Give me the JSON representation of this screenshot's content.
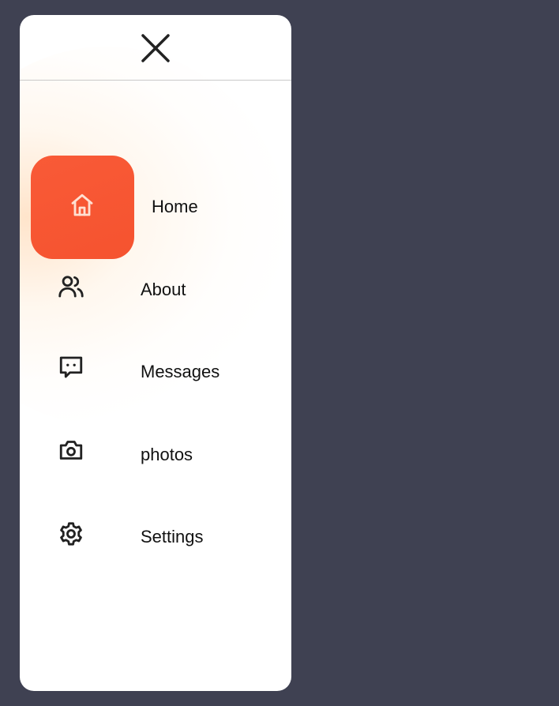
{
  "nav": {
    "items": [
      {
        "label": "Home",
        "icon": "home-icon",
        "active": true
      },
      {
        "label": "About",
        "icon": "users-icon",
        "active": false
      },
      {
        "label": "Messages",
        "icon": "message-icon",
        "active": false
      },
      {
        "label": "photos",
        "icon": "camera-icon",
        "active": false
      },
      {
        "label": "Settings",
        "icon": "gear-icon",
        "active": false
      }
    ]
  },
  "header": {
    "close_icon": "close-icon"
  },
  "colors": {
    "background": "#3f4152",
    "drawer": "#ffffff",
    "accent": "#f95a37",
    "text": "#111111"
  }
}
